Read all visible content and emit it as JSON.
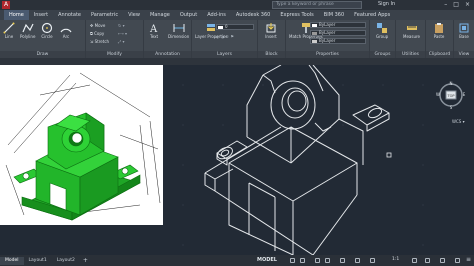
{
  "titlebar": {
    "search_placeholder": "Type a keyword or phrase",
    "signin": "Sign In",
    "win_controls": [
      "–",
      "□",
      "×"
    ]
  },
  "ribbon_tabs": [
    "Home",
    "Insert",
    "Annotate",
    "Parametric",
    "View",
    "Manage",
    "Output",
    "Add-ins",
    "Autodesk 360",
    "Express Tools",
    "BIM 360",
    "Featured Apps"
  ],
  "ribbon": {
    "draw": {
      "title": "Draw",
      "line": "Line",
      "polyline": "Polyline",
      "circle": "Circle",
      "arc": "Arc"
    },
    "modify": {
      "title": "Modify",
      "move": "Move",
      "copy": "Copy",
      "stretch": "Stretch"
    },
    "annotation": {
      "title": "Annotation",
      "text": "Text",
      "dimension": "Dimension"
    },
    "layers": {
      "title": "Layers",
      "layer_properties": "Layer Properties"
    },
    "block": {
      "title": "Block",
      "insert": "Insert"
    },
    "properties": {
      "title": "Properties",
      "match": "Match Properties",
      "bylayer": "ByLayer"
    },
    "groups": {
      "title": "Groups",
      "group": "Group"
    },
    "utilities": {
      "title": "Utilities",
      "measure": "Measure"
    },
    "clipboard": {
      "title": "Clipboard",
      "paste": "Paste"
    },
    "view": {
      "title": "View",
      "base": "Base"
    }
  },
  "colors": {
    "canvas": "#222a35",
    "ribbon": "#424951",
    "model_green": "#22c02a",
    "wireframe": "#e4e7ea"
  },
  "viewcube": {
    "north": "N",
    "south": "S",
    "west": "W",
    "east": "E",
    "face": "TOP"
  },
  "wcs_label": "WCS",
  "statusbar": {
    "layout_tabs": [
      "Model",
      "Layout1",
      "Layout2"
    ],
    "model": "MODEL",
    "scale": "1:1"
  }
}
